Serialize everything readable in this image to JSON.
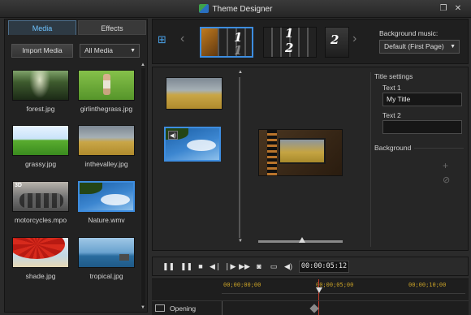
{
  "window": {
    "title": "Theme Designer",
    "restore_glyph": "❐",
    "close_glyph": "✕"
  },
  "left_panel": {
    "tabs": [
      {
        "label": "Media",
        "active": true
      },
      {
        "label": "Effects",
        "active": false
      }
    ],
    "import_button": "Import Media",
    "filter_value": "All Media",
    "media": [
      {
        "name": "forest.jpg",
        "image": "forest"
      },
      {
        "name": "girlinthegrass.jpg",
        "image": "girl"
      },
      {
        "name": "grassy.jpg",
        "image": "grassy"
      },
      {
        "name": "inthevalley.jpg",
        "image": "valley"
      },
      {
        "name": "motorcycles.mpo",
        "image": "motorcycles",
        "badge": "3D"
      },
      {
        "name": "Nature.wmv",
        "image": "nature",
        "selected": true
      },
      {
        "name": "shade.jpg",
        "image": "shade"
      },
      {
        "name": "tropical.jpg",
        "image": "tropical"
      }
    ]
  },
  "strip": {
    "templates": [
      {
        "numbers": [
          "1",
          "1"
        ],
        "selected": true
      },
      {
        "numbers": [
          "1",
          "2"
        ],
        "selected": false
      },
      {
        "numbers": [
          "2"
        ],
        "selected": false
      }
    ],
    "music_label": "Background music:",
    "music_value": "Default (First Page)"
  },
  "settings": {
    "section_title": "Title settings",
    "text1_label": "Text 1",
    "text1_value": "My Title",
    "text2_label": "Text 2",
    "text2_value": "",
    "background_label": "Background"
  },
  "transport": {
    "timecode": "00:00:05:12"
  },
  "timeline": {
    "ticks": [
      "00;00;00;00",
      "00;00;05;00",
      "00;00;10;00"
    ],
    "track_label": "Opening"
  },
  "colors": {
    "accent": "#3d8de0",
    "tab_active_text": "#6ec3ff",
    "tick_label": "#c9a227",
    "playhead": "#c43b2a"
  }
}
